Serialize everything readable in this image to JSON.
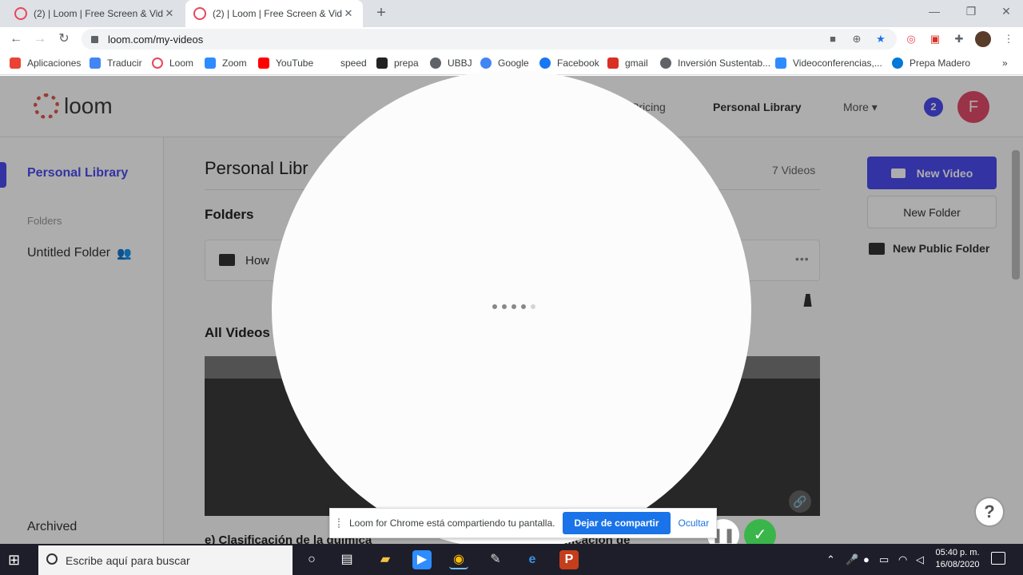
{
  "browser": {
    "tabs": [
      {
        "title": "(2) | Loom | Free Screen & Video",
        "active": false
      },
      {
        "title": "(2) | Loom | Free Screen & Video",
        "active": true
      }
    ],
    "new_tab_symbol": "+",
    "window_controls": [
      "—",
      "❐",
      "✕"
    ],
    "url": "loom.com/my-videos",
    "bookmarks": [
      {
        "label": "Aplicaciones",
        "icon": "apps-grid-icon",
        "color": "#ea4335"
      },
      {
        "label": "Traducir",
        "icon": "translate-icon",
        "color": "#4285f4"
      },
      {
        "label": "Loom",
        "icon": "loom-icon",
        "color": "#e8475b"
      },
      {
        "label": "Zoom",
        "icon": "zoom-icon",
        "color": "#2d8cff"
      },
      {
        "label": "YouTube",
        "icon": "youtube-icon",
        "color": "#ff0000"
      },
      {
        "label": "speed",
        "icon": "",
        "color": ""
      },
      {
        "label": "prepa",
        "icon": "gem-icon",
        "color": "#222222"
      },
      {
        "label": "UBBJ",
        "icon": "globe-icon",
        "color": "#5f6368"
      },
      {
        "label": "Google",
        "icon": "google-icon",
        "color": "#4285f4"
      },
      {
        "label": "Facebook",
        "icon": "facebook-icon",
        "color": "#1877f2"
      },
      {
        "label": "gmail",
        "icon": "gmail-icon",
        "color": "#d93025"
      },
      {
        "label": "Inversión Sustentab...",
        "icon": "globe-icon",
        "color": "#5f6368"
      },
      {
        "label": "Videoconferencias,...",
        "icon": "zoom-icon",
        "color": "#2d8cff"
      },
      {
        "label": "Prepa Madero",
        "icon": "edge-icon",
        "color": "#0078d7"
      }
    ],
    "bookmarks_more": "»"
  },
  "loom": {
    "logo_text": "loom",
    "nav": {
      "pricing": "Pricing",
      "library": "Personal Library",
      "more": "More ▾"
    },
    "notifications_count": "2",
    "avatar_letter": "F",
    "sidebar": {
      "personal_library": "Personal Library",
      "folders_heading": "Folders",
      "untitled_folder": "Untitled Folder",
      "archived": "Archived"
    },
    "main": {
      "title": "Personal Libr",
      "video_count": "7 Videos",
      "folders_heading": "Folders",
      "folder_name": "How",
      "folder_more": "•••",
      "all_videos_heading": "All Videos",
      "video_title_left": "e) Clasificación de la química",
      "video_title_right": "ificación de"
    },
    "actions": {
      "new_video": "New Video",
      "new_folder": "New Folder",
      "new_public_folder": "New Public Folder"
    },
    "help": "?"
  },
  "recorder": {
    "loading_dots": 5,
    "pause_symbol": "❚❚",
    "done_symbol": "✓"
  },
  "share_bar": {
    "message": "Loom for Chrome está compartiendo tu pantalla.",
    "stop_label": "Dejar de compartir",
    "hide_label": "Ocultar"
  },
  "taskbar": {
    "search_placeholder": "Escribe aquí para buscar",
    "time": "05:40 p. m.",
    "date": "16/08/2020",
    "accent": "#76b9ed"
  }
}
